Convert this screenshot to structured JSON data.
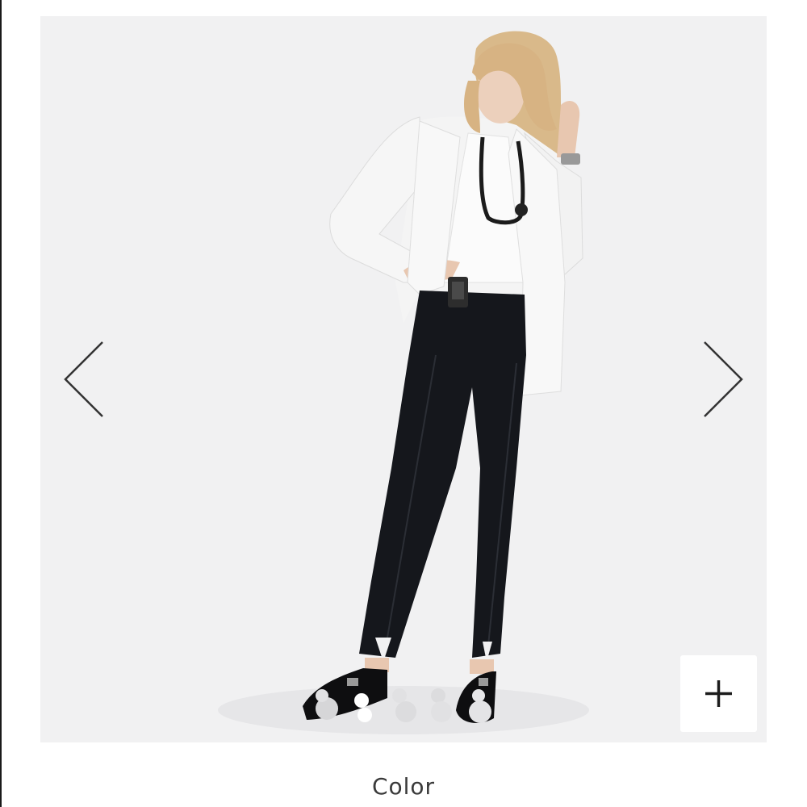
{
  "gallery": {
    "photo_description_icon": "product-model-photo",
    "prev_icon": "chevron-left-icon",
    "next_icon": "chevron-right-icon",
    "zoom_icon": "plus-icon",
    "image_count": 4,
    "active_index": 1
  },
  "product": {
    "color_label": "Color"
  },
  "colors": {
    "gallery_bg": "#f1f1f2",
    "jacket": "#f7f7f7",
    "pants": "#15171c",
    "hair": "#d9b98a",
    "skin": "#e8c7b0",
    "arrow": "#333333"
  }
}
